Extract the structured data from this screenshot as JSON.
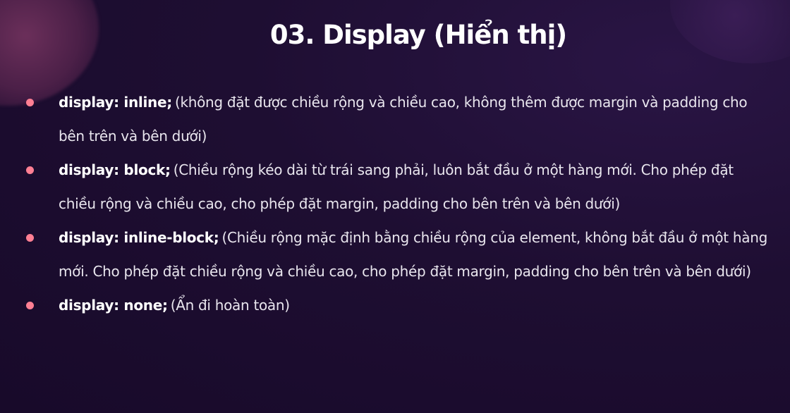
{
  "slide": {
    "title": "03. Display (Hiển thị)",
    "accent_bullet_color": "#ff7f93",
    "items": [
      {
        "code": "display: inline;",
        "description": "(không đặt được chiều rộng và chiều cao, không thêm được margin và padding cho bên trên và bên dưới)"
      },
      {
        "code": "display: block;",
        "description": "(Chiều rộng kéo dài từ trái sang phải, luôn bắt đầu ở một hàng mới. Cho phép đặt chiều rộng và chiều cao, cho phép đặt margin, padding cho bên trên và bên dưới)"
      },
      {
        "code": "display: inline-block;",
        "description": "(Chiều rộng mặc định bằng chiều rộng của element, không bắt đầu ở một hàng mới. Cho phép đặt chiều rộng và chiều cao, cho phép đặt margin, padding cho bên trên và bên dưới)"
      },
      {
        "code": "display: none;",
        "description": "(Ẩn đi hoàn toàn)"
      }
    ]
  }
}
